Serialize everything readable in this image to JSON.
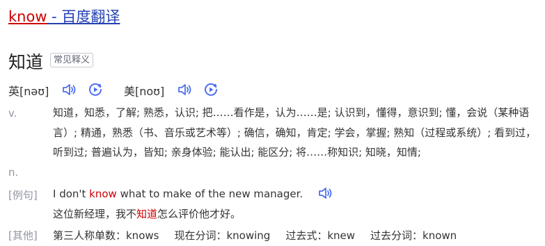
{
  "header": {
    "title_word": "know",
    "title_rest": " - 百度翻译"
  },
  "entry": {
    "headword": "知道",
    "tag": "常见释义"
  },
  "pronunciation": {
    "uk_label": "英[nəʊ]",
    "us_label": "美[noʊ]"
  },
  "definitions": {
    "pos_v": "v.",
    "pos_n": "n.",
    "text": "知道，知悉，了解; 熟悉，认识; 把……看作是，认为……是; 认识到，懂得，意识到; 懂，会说（某种语言）; 精通，熟悉（书、音乐或艺术等）; 确信，确知，肯定; 学会，掌握; 熟知（过程或系统）; 看到过，听到过; 普遍认为，皆知; 亲身体验; 能认出; 能区分; 将……称知识; 知晓，知情;"
  },
  "example": {
    "label": "[例句]",
    "en_before": "I don't ",
    "en_key": "know",
    "en_after": " what to make of the new manager.",
    "zh_before": "这位新经理，我不",
    "zh_key": "知道",
    "zh_after": "怎么评价他才好。"
  },
  "other": {
    "label": "[其他]",
    "third_person": "第三人称单数：knows",
    "present_participle": "现在分词：knowing",
    "past_tense": "过去式：knew",
    "past_participle": "过去分词：known"
  },
  "colors": {
    "link": "#2440b3",
    "highlight": "#c00000",
    "icon": "#4e6ef2",
    "muted": "#9195a3"
  },
  "icons": [
    "speaker-icon",
    "play-circle-icon"
  ]
}
